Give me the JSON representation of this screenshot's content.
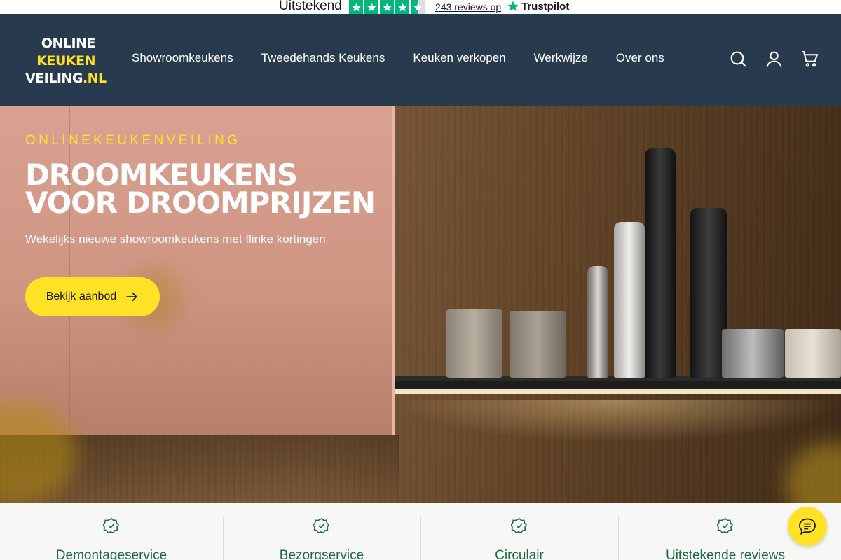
{
  "trustpilot": {
    "rating_text": "Uitstekend",
    "reviews_text": "243 reviews op",
    "brand": "Trustpilot",
    "stars": 4.5,
    "star_color": "#00b67a"
  },
  "logo": {
    "line1": "ONLINE",
    "line2": "KEUKEN",
    "line3": "VEILING",
    "line3_suffix": ".NL"
  },
  "nav": {
    "items": [
      {
        "label": "Showroomkeukens"
      },
      {
        "label": "Tweedehands Keukens"
      },
      {
        "label": "Keuken verkopen"
      },
      {
        "label": "Werkwijze"
      },
      {
        "label": "Over ons"
      }
    ]
  },
  "header_icons": [
    "search-icon",
    "account-icon",
    "cart-icon"
  ],
  "hero": {
    "eyebrow": "ONLINEKEUKENVEILING",
    "title": "DROOMKEUKENS VOOR DROOMPRIJZEN",
    "subtitle": "Wekelijks nieuwe showroomkeukens met flinke kortingen",
    "cta_label": "Bekijk aanbod"
  },
  "usp": {
    "items": [
      {
        "label": "Demontageservice"
      },
      {
        "label": "Bezorgservice"
      },
      {
        "label": "Circulair"
      },
      {
        "label": "Uitstekende reviews"
      }
    ]
  },
  "colors": {
    "header_bg": "#283a4e",
    "accent_yellow": "#ffe226",
    "usp_green": "#1e6b4a"
  }
}
